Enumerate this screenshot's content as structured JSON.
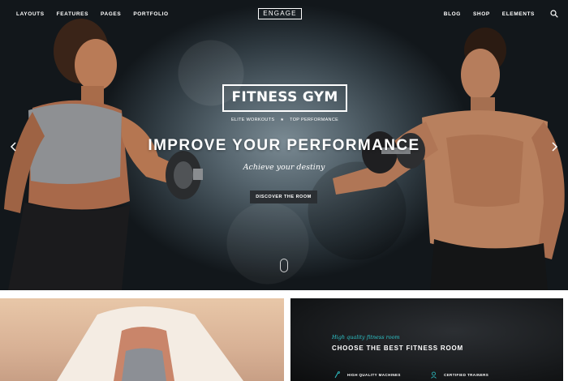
{
  "nav": {
    "left": [
      "LAYOUTS",
      "FEATURES",
      "PAGES",
      "PORTFOLIO"
    ],
    "logo": "ENGAGE",
    "right": [
      "BLOG",
      "SHOP",
      "ELEMENTS"
    ]
  },
  "hero": {
    "badge": "FITNESS GYM",
    "badge_sub_left": "ELITE WORKOUTS",
    "badge_sub_right": "TOP PERFORMANCE",
    "headline": "IMPROVE YOUR PERFORMANCE",
    "tagline": "Achieve your destiny",
    "cta_label": "DISCOVER THE ROOM"
  },
  "section": {
    "eyebrow": "High quality fitness room",
    "title": "CHOOSE THE BEST FITNESS ROOM",
    "features": [
      "HIGH QUALITY MACHINES",
      "CERTIFIED TRAINERS"
    ]
  },
  "colors": {
    "accent": "#2ec4c9",
    "button_bg": "#2b2f33"
  },
  "icons": [
    "search-icon",
    "chevron-left-icon",
    "chevron-right-icon",
    "scroll-mouse-icon",
    "machine-icon",
    "trainer-icon"
  ]
}
